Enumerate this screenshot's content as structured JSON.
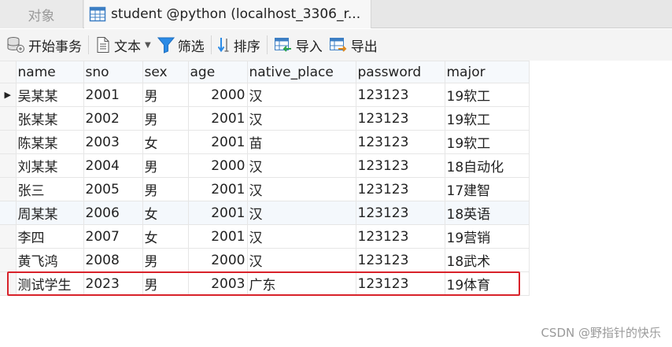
{
  "tabs": {
    "objects": "对象",
    "active": "student @python (localhost_3306_r..."
  },
  "toolbar": {
    "begin_transaction": "开始事务",
    "text": "文本",
    "filter": "筛选",
    "sort": "排序",
    "import": "导入",
    "export": "导出"
  },
  "table": {
    "columns": [
      "name",
      "sno",
      "sex",
      "age",
      "native_place",
      "password",
      "major"
    ],
    "rows": [
      [
        "吴某某",
        "2001",
        "男",
        "2000",
        "汉",
        "123123",
        "19软工"
      ],
      [
        "张某某",
        "2002",
        "男",
        "2001",
        "汉",
        "123123",
        "19软工"
      ],
      [
        "陈某某",
        "2003",
        "女",
        "2001",
        "苗",
        "123123",
        "19软工"
      ],
      [
        "刘某某",
        "2004",
        "男",
        "2000",
        "汉",
        "123123",
        "18自动化"
      ],
      [
        "张三",
        "2005",
        "男",
        "2001",
        "汉",
        "123123",
        "17建智"
      ],
      [
        "周某某",
        "2006",
        "女",
        "2001",
        "汉",
        "123123",
        "18英语"
      ],
      [
        "李四",
        "2007",
        "女",
        "2001",
        "汉",
        "123123",
        "19营销"
      ],
      [
        "黄飞鸿",
        "2008",
        "男",
        "2000",
        "汉",
        "123123",
        "18武术"
      ],
      [
        "测试学生",
        "2023",
        "男",
        "2003",
        "广东",
        "123123",
        "19体育"
      ]
    ]
  },
  "watermark": "CSDN @野指针的快乐",
  "colors": {
    "highlight": "#d8222a",
    "filter_icon": "#2b8be6"
  }
}
